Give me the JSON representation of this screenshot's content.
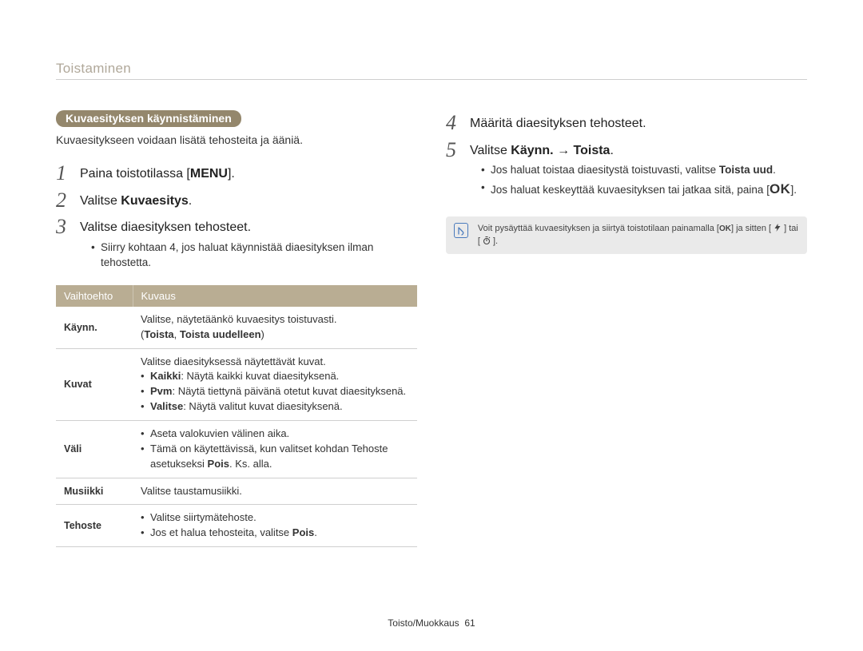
{
  "header": {
    "title": "Toistaminen"
  },
  "left": {
    "section_title": "Kuvaesityksen käynnistäminen",
    "intro": "Kuvaesitykseen voidaan lisätä tehosteita ja ääniä.",
    "steps": [
      {
        "pre": "Paina toistotilassa [",
        "button": "MENU",
        "post": "]."
      },
      {
        "pre": "Valitse ",
        "bold": "Kuvaesitys",
        "post": "."
      },
      {
        "text": "Valitse diaesityksen tehosteet.",
        "sub": [
          "Siirry kohtaan 4, jos haluat käynnistää diaesityksen ilman tehostetta."
        ]
      }
    ],
    "table": {
      "head": [
        "Vaihtoehto",
        "Kuvaus"
      ],
      "rows": [
        {
          "name": "Käynn.",
          "desc": "Valitse, näytetäänkö kuvaesitys toistuvasti.",
          "desc2_pre": "(",
          "desc2_bold1": "Toista",
          "desc2_mid": ", ",
          "desc2_bold2": "Toista uudelleen",
          "desc2_post": ")"
        },
        {
          "name": "Kuvat",
          "desc": "Valitse diaesityksessä näytettävät kuvat.",
          "bullets": [
            {
              "bold": "Kaikki",
              "text": ": Näytä kaikki kuvat diaesityksenä."
            },
            {
              "bold": "Pvm",
              "text": ": Näytä tiettynä päivänä otetut kuvat diaesityksenä."
            },
            {
              "bold": "Valitse",
              "text": ": Näytä valitut kuvat diaesityksenä."
            }
          ]
        },
        {
          "name": "Väli",
          "bullets": [
            {
              "text": "Aseta valokuvien välinen aika."
            },
            {
              "pre": "Tämä on käytettävissä, kun valitset kohdan Tehoste asetukseksi ",
              "bold": "Pois",
              "post": ". Ks. alla."
            }
          ]
        },
        {
          "name": "Musiikki",
          "desc": "Valitse taustamusiikki."
        },
        {
          "name": "Tehoste",
          "bullets": [
            {
              "text": "Valitse siirtymätehoste."
            },
            {
              "pre": "Jos et halua tehosteita, valitse ",
              "bold": "Pois",
              "post": "."
            }
          ]
        }
      ]
    }
  },
  "right": {
    "steps": [
      {
        "n": 4,
        "text": "Määritä diaesityksen tehosteet."
      },
      {
        "n": 5,
        "pre": "Valitse ",
        "bold": "Käynn. → Toista",
        "post": ".",
        "sub": [
          {
            "pre": "Jos haluat toistaa diaesitystä toistuvasti, valitse ",
            "bold": "Toista uud",
            "post": "."
          },
          {
            "pre": "Jos haluat keskeyttää kuvaesityksen tai jatkaa sitä, paina [",
            "ok": "OK",
            "post": "]."
          }
        ]
      }
    ],
    "note": {
      "text_pre": "Voit pysäyttää kuvaesityksen ja siirtyä toistotilaan painamalla [",
      "ok": "OK",
      "text_mid": "] ja sitten [",
      "or": "] tai [",
      "text_post": "]."
    }
  },
  "footer": {
    "text": "Toisto/Muokkaus",
    "page": "61"
  }
}
